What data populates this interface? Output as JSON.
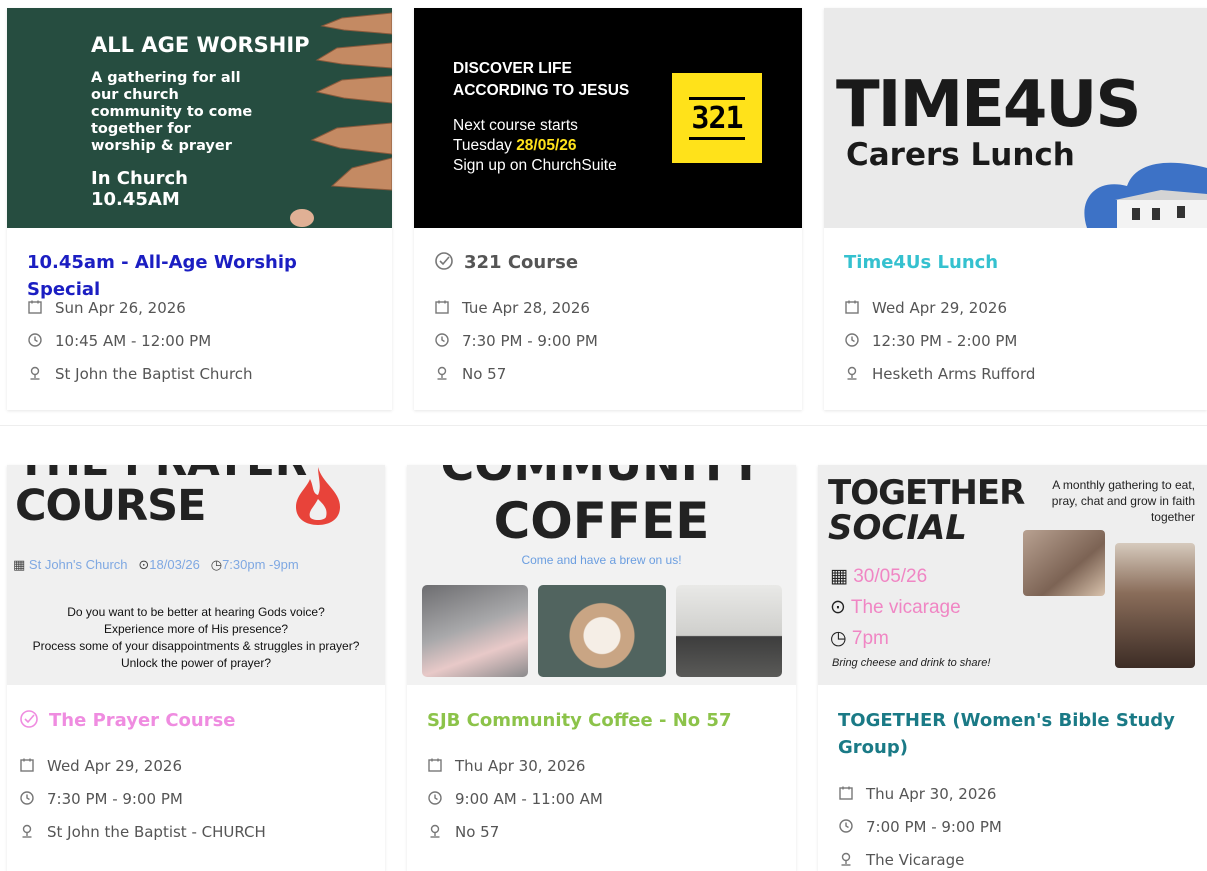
{
  "colors": {
    "card_bg": "#ffffff",
    "banner_green": "#264d40",
    "banner_black": "#000000",
    "banner_light": "#eaeaea",
    "accent_yellow": "#ffe21a",
    "pink": "#e85ccc",
    "blue_text": "#1b1ec2"
  },
  "events": [
    {
      "banner": {
        "heading": "ALL AGE WORSHIP",
        "lines": [
          "A gathering for all",
          "our church",
          "community to come",
          "together for",
          "worship & prayer"
        ],
        "time_line1": "In Church",
        "time_line2": "10.45AM"
      },
      "title": "10.45am - All-Age Worship Special",
      "title_color": "#1b1ec2",
      "date": "Sun Apr 26, 2026",
      "time": "10:45 AM - 12:00 PM",
      "location": "St John the Baptist Church"
    },
    {
      "banner": {
        "line1": "DISCOVER LIFE",
        "line2": "ACCORDING TO JESUS",
        "line3": "Next course starts",
        "line4_prefix": "Tuesday",
        "line4_date": "28/05/26",
        "line5": "Sign up on ChurchSuite",
        "logo": "321"
      },
      "title": "321 Course",
      "title_color": "#555555",
      "date": "Tue Apr 28, 2026",
      "time": "7:30 PM - 9:00 PM",
      "location": "No 57"
    },
    {
      "banner": {
        "big": "TIME4US",
        "sub": "Carers Lunch"
      },
      "title": "Time4Us Lunch",
      "title_color": "#35c1cf",
      "date": "Wed Apr 29, 2026",
      "time": "12:30 PM - 2:00 PM",
      "location": "Hesketh Arms Rufford"
    },
    {
      "banner": {
        "top": "THE PRAYER",
        "big": "COURSE",
        "chip_place": "St John's Church",
        "chip_date": "18/03/26",
        "chip_time": "7:30pm -9pm",
        "q1": "Do you want to be better at hearing Gods voice?",
        "q2": "Experience more of His presence?",
        "q3": "Process some of your disappointments & struggles in prayer?",
        "q4": "Unlock the power of prayer?"
      },
      "title": "The Prayer Course",
      "title_color": "#ef8ce0",
      "date": "Wed Apr 29, 2026",
      "time": "7:30 PM - 9:00 PM",
      "location": "St John the Baptist - CHURCH"
    },
    {
      "banner": {
        "top": "COMMUNITY",
        "big": "COFFEE",
        "sub": "Come and have a brew on us!"
      },
      "title": "SJB Community Coffee - No 57",
      "title_color": "#8cc34a",
      "date": "Thu Apr 30, 2026",
      "time": "9:00 AM - 11:00 AM",
      "location": "No 57"
    },
    {
      "banner": {
        "big1": "TOGETHER",
        "big2": "SOCIAL",
        "tag": "A monthly gathering to eat, pray, chat and grow in faith together",
        "date": "30/05/26",
        "place": "The vicarage",
        "time": "7pm",
        "note": "Bring cheese and drink to share!"
      },
      "title": "TOGETHER (Women's Bible Study Group)",
      "title_color": "#1a7a86",
      "date": "Thu Apr 30, 2026",
      "time": "7:00 PM - 9:00 PM",
      "location": "The Vicarage"
    }
  ]
}
